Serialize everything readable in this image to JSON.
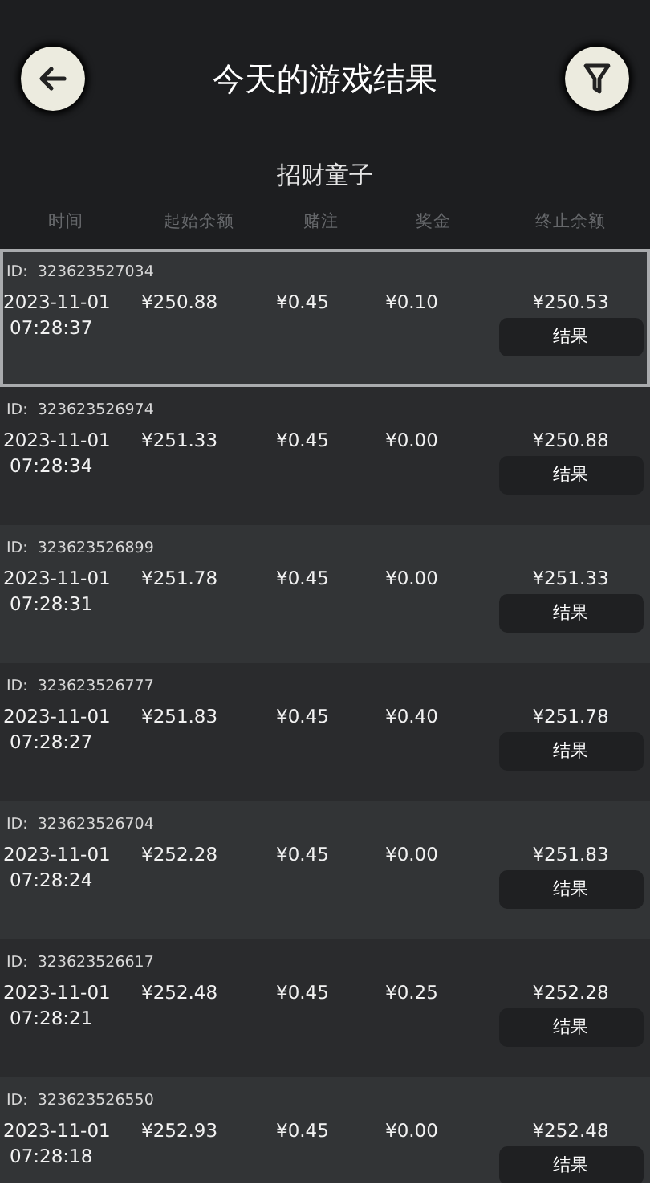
{
  "header": {
    "title": "今天的游戏结果"
  },
  "subtitle": "招财童子",
  "columns": [
    "时间",
    "起始余额",
    "赌注",
    "奖金",
    "终止余额"
  ],
  "rows": [
    {
      "id": "ID:  323623527034",
      "date": "2023-11-01",
      "time": "07:28:37",
      "start": "¥250.88",
      "bet": "¥0.45",
      "prize": "¥0.10",
      "end": "¥250.53",
      "button": "结果",
      "selected": true
    },
    {
      "id": "ID:  323623526974",
      "date": "2023-11-01",
      "time": "07:28:34",
      "start": "¥251.33",
      "bet": "¥0.45",
      "prize": "¥0.00",
      "end": "¥250.88",
      "button": "结果",
      "selected": false
    },
    {
      "id": "ID:  323623526899",
      "date": "2023-11-01",
      "time": "07:28:31",
      "start": "¥251.78",
      "bet": "¥0.45",
      "prize": "¥0.00",
      "end": "¥251.33",
      "button": "结果",
      "selected": false
    },
    {
      "id": "ID:  323623526777",
      "date": "2023-11-01",
      "time": "07:28:27",
      "start": "¥251.83",
      "bet": "¥0.45",
      "prize": "¥0.40",
      "end": "¥251.78",
      "button": "结果",
      "selected": false
    },
    {
      "id": "ID:  323623526704",
      "date": "2023-11-01",
      "time": "07:28:24",
      "start": "¥252.28",
      "bet": "¥0.45",
      "prize": "¥0.00",
      "end": "¥251.83",
      "button": "结果",
      "selected": false
    },
    {
      "id": "ID:  323623526617",
      "date": "2023-11-01",
      "time": "07:28:21",
      "start": "¥252.48",
      "bet": "¥0.45",
      "prize": "¥0.25",
      "end": "¥252.28",
      "button": "结果",
      "selected": false
    },
    {
      "id": "ID:  323623526550",
      "date": "2023-11-01",
      "time": "07:28:18",
      "start": "¥252.93",
      "bet": "¥0.45",
      "prize": "¥0.00",
      "end": "¥252.48",
      "button": "结果",
      "selected": false
    }
  ]
}
